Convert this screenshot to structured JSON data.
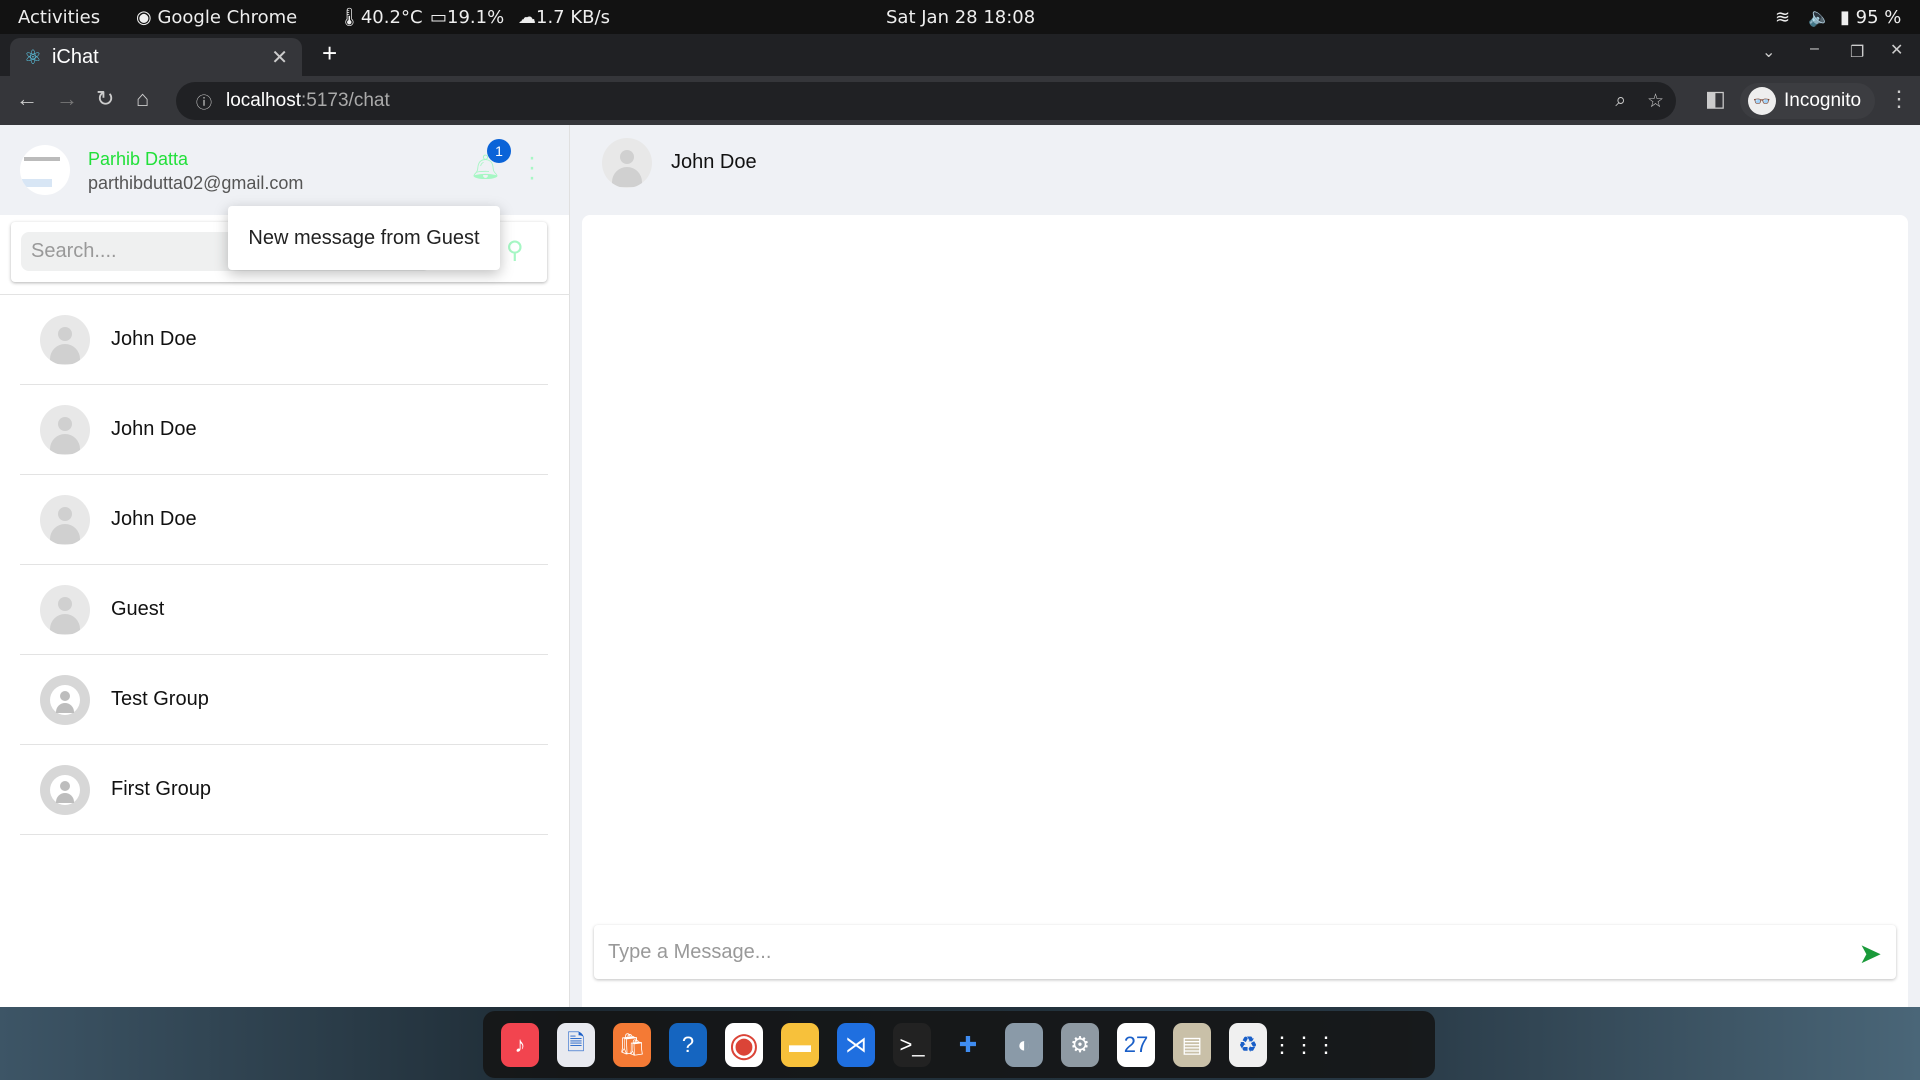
{
  "system_bar": {
    "activities": "Activities",
    "app": "Google Chrome",
    "temp": "40.2°C",
    "cpu": "19.1%",
    "net": "1.7 KB/s",
    "clock": "Sat Jan 28  18:08",
    "battery": "95 %"
  },
  "browser": {
    "tab_title": "iChat",
    "url_host": "localhost",
    "url_path": ":5173/chat",
    "profile": "Incognito"
  },
  "user": {
    "name": "Parhib Datta",
    "email": "parthibdutta02@gmail.com",
    "notification_count": "1"
  },
  "notification": {
    "text": "New message from Guest"
  },
  "search": {
    "placeholder": "Search...."
  },
  "contacts": [
    {
      "name": "John Doe",
      "type": "user"
    },
    {
      "name": "John Doe",
      "type": "user"
    },
    {
      "name": "John Doe",
      "type": "user"
    },
    {
      "name": "Guest",
      "type": "user"
    },
    {
      "name": "Test Group",
      "type": "group"
    },
    {
      "name": "First Group",
      "type": "group"
    }
  ],
  "chat": {
    "title": "John Doe",
    "input_placeholder": "Type a Message..."
  },
  "colors": {
    "accent_green": "#22e03a",
    "icon_mint": "#a6f7c4",
    "badge_blue": "#0a63d8",
    "send_green": "#1a9a3a"
  },
  "dock": [
    "music",
    "writer",
    "software",
    "help",
    "chrome",
    "files",
    "vscode",
    "terminal",
    "extensions",
    "toggle",
    "settings",
    "calendar",
    "archive",
    "trash",
    "app-grid"
  ],
  "dock_calendar_day": "27"
}
